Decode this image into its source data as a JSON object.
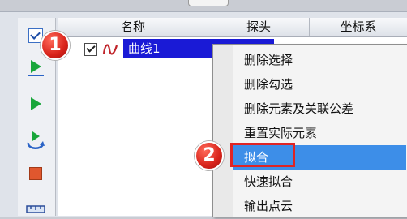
{
  "header": {
    "col_name": "名称",
    "col_probe": "探头",
    "col_coord": "坐标系"
  },
  "tree": {
    "item_label": "曲线1"
  },
  "context_menu": {
    "items": [
      "删除选择",
      "删除勾选",
      "删除元素及关联公差",
      "重置实际元素",
      "拟合",
      "快速拟合",
      "输出点云"
    ],
    "highlighted_index": 4
  },
  "annotations": {
    "step1": "1",
    "step2": "2"
  },
  "colors": {
    "selection": "#1a1ad6",
    "menu_highlight": "#3d8ee8",
    "callout": "#e02424"
  },
  "icons": [
    "check-all-icon",
    "run-icon",
    "play-icon",
    "loop-run-icon",
    "stop-icon",
    "ruler-icon",
    "curve-icon"
  ]
}
